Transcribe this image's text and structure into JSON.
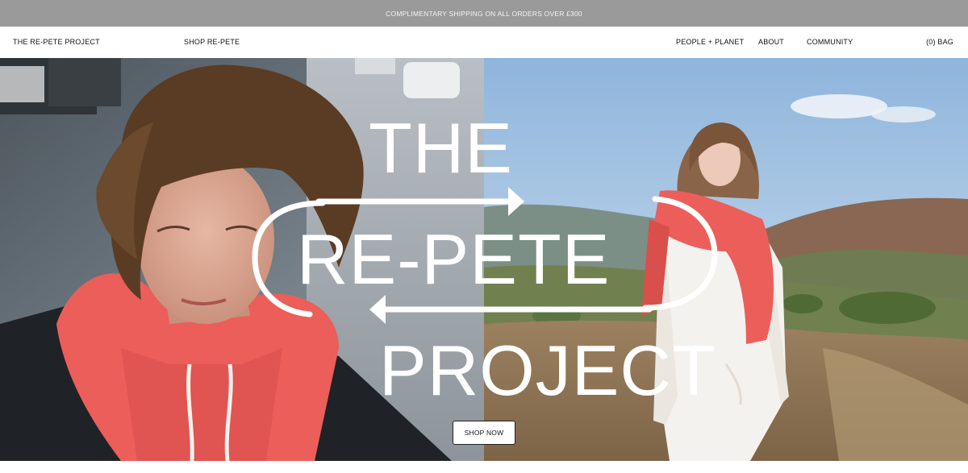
{
  "announcement": "COMPLIMENTARY SHIPPING ON ALL ORDERS OVER £300",
  "nav": {
    "logo": "THE RE-PETE PROJECT",
    "shop": "SHOP RE-PETE",
    "people_planet": "PEOPLE + PLANET",
    "about": "ABOUT",
    "community": "COMMUNITY",
    "bag": "(0) BAG"
  },
  "hero": {
    "line1": "THE",
    "line2": "RE-PETE",
    "line3": "PROJECT",
    "cta": "SHOP NOW"
  },
  "colors": {
    "announcement_bg": "#9a9a9a",
    "hoodie_coral": "#ec5e5a",
    "sky_blue": "#a9c9e6",
    "hill_brown": "#8a6b4c"
  }
}
